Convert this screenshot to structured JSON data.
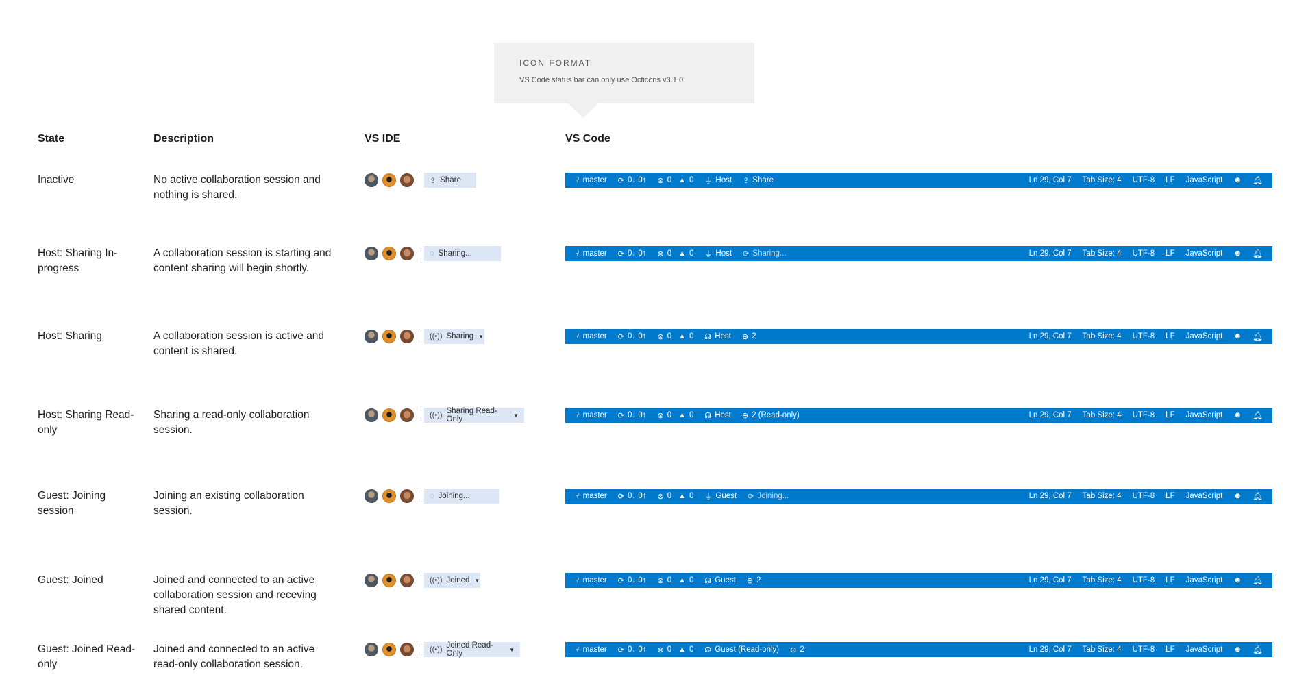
{
  "callout": {
    "title": "ICON FORMAT",
    "body": "VS Code status bar can only use Octicons v3.1.0."
  },
  "headers": {
    "state": "State",
    "description": "Description",
    "vs_ide": "VS IDE",
    "vs_code": "VS Code"
  },
  "statusbar": {
    "branch": "master",
    "sync": "0↓ 0↑",
    "errors": "0",
    "warnings": "0",
    "position": "Ln 29, Col 7",
    "tab_size": "Tab Size: 4",
    "encoding": "UTF-8",
    "eol": "LF",
    "language": "JavaScript",
    "colors": {
      "background": "#007acc",
      "foreground": "#ffffff"
    }
  },
  "rows": [
    {
      "state": "Inactive",
      "description": "No active collaboration session and nothing is shared.",
      "ide_label": "Share",
      "ide_icon": "share-icon",
      "code_role": "Host",
      "code_role_icon": "plug-icon",
      "code_status": "Share",
      "code_status_icon": "share-icon"
    },
    {
      "state": "Host: Sharing In-progress",
      "description": "A collaboration session is starting and content sharing will begin shortly.",
      "ide_label": "Sharing...",
      "ide_icon": "spinner-icon",
      "code_role": "Host",
      "code_role_icon": "plug-icon",
      "code_status": "Sharing...",
      "code_status_icon": "sync-icon"
    },
    {
      "state": "Host: Sharing",
      "description": "A collaboration session is active and content is shared.",
      "ide_label": "Sharing",
      "ide_icon": "broadcast-icon",
      "code_role": "Host",
      "code_role_icon": "radio-tower-icon",
      "code_status": "2",
      "code_status_icon": "globe-icon"
    },
    {
      "state": "Host: Sharing Read-only",
      "description": "Sharing a read-only collaboration session.",
      "ide_label": "Sharing Read-Only",
      "ide_icon": "broadcast-icon",
      "code_role": "Host",
      "code_role_icon": "radio-tower-icon",
      "code_status": "2 (Read-only)",
      "code_status_icon": "globe-icon"
    },
    {
      "state": "Guest: Joining session",
      "description": "Joining an existing collaboration session.",
      "ide_label": "Joining...",
      "ide_icon": "spinner-icon",
      "code_role": "Guest",
      "code_role_icon": "plug-icon",
      "code_status": "Joining...",
      "code_status_icon": "sync-icon"
    },
    {
      "state": "Guest: Joined",
      "description": "Joined and connected to an active collaboration session and receving shared content.",
      "ide_label": "Joined",
      "ide_icon": "broadcast-icon",
      "code_role": "Guest",
      "code_role_icon": "radio-tower-icon",
      "code_status": "2",
      "code_status_icon": "globe-icon"
    },
    {
      "state": "Guest: Joined Read-only",
      "description": "Joined and connected to an active read-only collaboration session.",
      "ide_label": "Joined Read-Only",
      "ide_icon": "broadcast-icon",
      "code_role": "Guest (Read-only)",
      "code_role_icon": "radio-tower-icon",
      "code_status": "2",
      "code_status_icon": "globe-icon"
    }
  ]
}
